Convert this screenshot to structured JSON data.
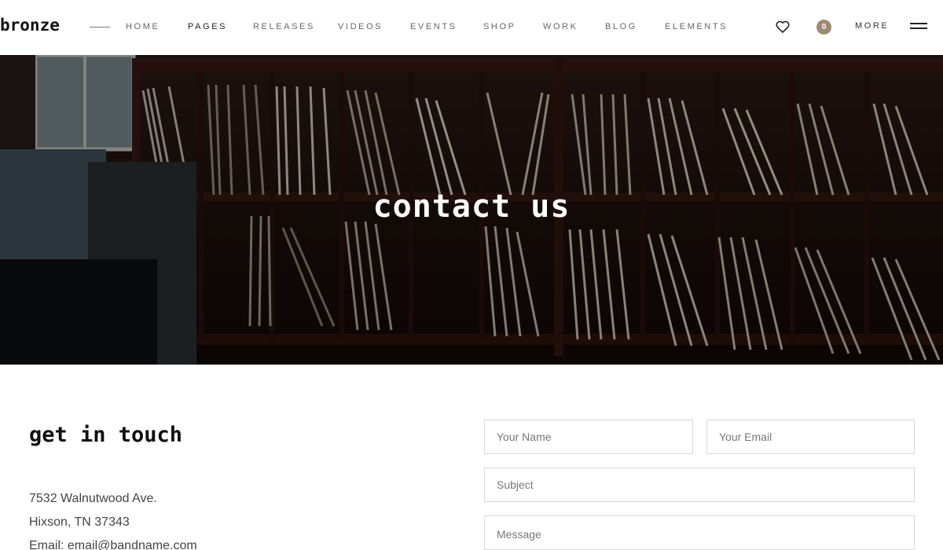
{
  "header": {
    "logo": "bronze",
    "nav": [
      {
        "label": "HOME",
        "active": false
      },
      {
        "label": "PAGES",
        "active": true
      },
      {
        "label": "RELEASES",
        "active": false
      },
      {
        "label": "VIDEOS",
        "active": false
      },
      {
        "label": "EVENTS",
        "active": false
      },
      {
        "label": "SHOP",
        "active": false
      },
      {
        "label": "WORK",
        "active": false
      },
      {
        "label": "BLOG",
        "active": false
      },
      {
        "label": "ELEMENTS",
        "active": false
      }
    ],
    "cart_count": "0",
    "more_label": "MORE"
  },
  "hero": {
    "title": "contact us"
  },
  "contact": {
    "heading": "get in touch",
    "address_lines": [
      "7532 Walnutwood Ave.",
      "Hixson, TN 37343",
      "Email: email@bandname.com"
    ]
  },
  "form": {
    "name_placeholder": "Your Name",
    "email_placeholder": "Your Email",
    "subject_placeholder": "Subject",
    "message_placeholder": "Message"
  },
  "colors": {
    "accent": "#9c8a72",
    "hero_overlay": "#1a0f0c"
  }
}
